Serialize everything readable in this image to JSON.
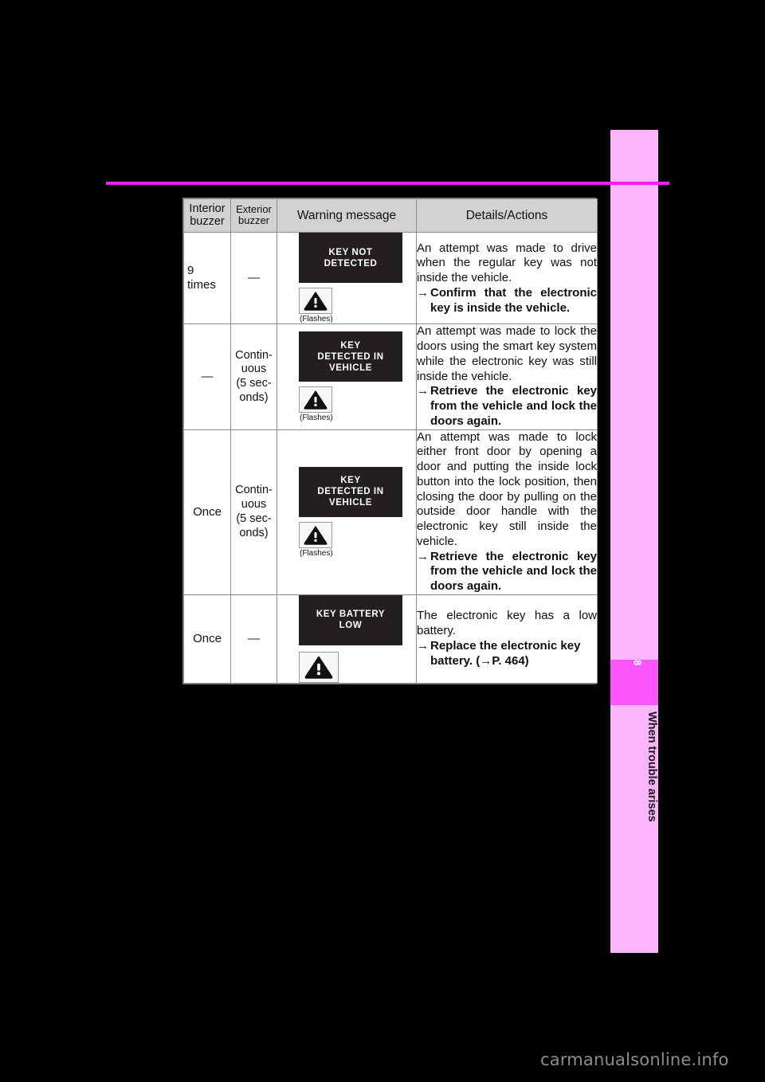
{
  "page": {
    "background_color": "#000000",
    "rule_color": "#f21ff2",
    "watermark": "carmanualsonline.info"
  },
  "sidebar": {
    "band_color": "#fcb4fb",
    "chapter_block_color": "#fc55fc",
    "chapter_number": "8",
    "chapter_title": "When trouble arises"
  },
  "table": {
    "headers": {
      "interior_buzzer": "Interior\nbuzzer",
      "interior_buzzer_line1": "Interior",
      "interior_buzzer_line2": "buzzer",
      "exterior_buzzer_line1": "Exterior",
      "exterior_buzzer_line2": "buzzer",
      "warning_message": "Warning message",
      "details_actions": "Details/Actions"
    },
    "rows": [
      {
        "interior_buzzer": "9\ntimes",
        "interior_buzzer_line1": "9",
        "interior_buzzer_line2": "times",
        "exterior_buzzer": "—",
        "screen_text": "KEY NOT\nDETECTED",
        "icon": "warning-triangle-icon",
        "icon_caption": "(Flashes)",
        "details": "An attempt was made to drive when the regular key was not inside the vehicle.",
        "action_arrow": "→",
        "action": "Confirm that the electronic key is inside the vehicle."
      },
      {
        "interior_buzzer": "—",
        "exterior_buzzer_line1": "Contin-",
        "exterior_buzzer_line2": "uous",
        "exterior_buzzer_line3": "(5 sec-",
        "exterior_buzzer_line4": "onds)",
        "screen_text": "KEY\nDETECTED IN\nVEHICLE",
        "icon": "warning-triangle-icon",
        "icon_caption": "(Flashes)",
        "details": "An attempt was made to lock the doors using the smart key system while the electronic key was still inside the vehicle.",
        "action_arrow": "→",
        "action": "Retrieve the electronic key from the vehicle and lock the doors again."
      },
      {
        "interior_buzzer": "Once",
        "exterior_buzzer_line1": "Contin-",
        "exterior_buzzer_line2": "uous",
        "exterior_buzzer_line3": "(5 sec-",
        "exterior_buzzer_line4": "onds)",
        "screen_text": "KEY\nDETECTED IN\nVEHICLE",
        "icon": "warning-triangle-icon",
        "icon_caption": "(Flashes)",
        "details": "An attempt was made to lock either front door by opening a door and putting the inside lock button into the lock position, then closing the door by pulling on the outside door handle with the electronic key still inside the vehicle.",
        "action_arrow": "→",
        "action": "Retrieve the electronic key from the vehicle and lock the doors again."
      },
      {
        "interior_buzzer": "Once",
        "exterior_buzzer": "—",
        "screen_text": "KEY BATTERY\nLOW",
        "icon": "warning-triangle-icon",
        "icon_caption": "",
        "details": "The electronic key has a low battery.",
        "action_arrow": "→",
        "action": "Replace the electronic key battery. (→P. 464)"
      }
    ]
  }
}
